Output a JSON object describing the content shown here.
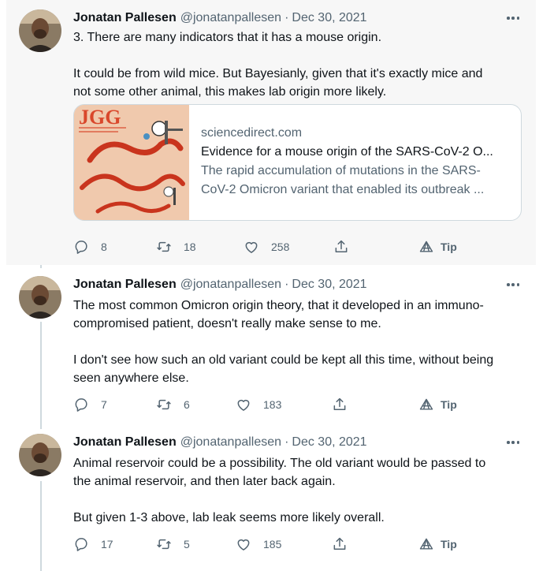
{
  "tweets": [
    {
      "name": "Jonatan Pallesen",
      "handle": "@jonatanpallesen",
      "separator": "·",
      "date": "Dec 30, 2021",
      "lines": [
        "3. There are many indicators that it has a mouse origin.",
        "",
        "It could be from wild mice. But Bayesianly, given that it's exactly mice and",
        "not some other animal, this makes lab origin more likely."
      ],
      "card": {
        "thumb_text": "JGG",
        "domain": "sciencedirect.com",
        "title": "Evidence for a mouse origin of the SARS-CoV-2 O...",
        "description_lines": [
          "The rapid accumulation of mutations in the SARS-",
          "CoV-2 Omicron variant that enabled its outbreak ..."
        ]
      },
      "actions": {
        "replies": "8",
        "retweets": "18",
        "likes": "258",
        "tip": "Tip"
      }
    },
    {
      "name": "Jonatan Pallesen",
      "handle": "@jonatanpallesen",
      "separator": "·",
      "date": "Dec 30, 2021",
      "lines": [
        "The most common Omicron origin theory, that it developed in an immuno-",
        "compromised patient, doesn't really make sense to me.",
        "",
        "I don't see how such an old variant could be kept all this time, without being",
        "seen anywhere else."
      ],
      "actions": {
        "replies": "7",
        "retweets": "6",
        "likes": "183",
        "tip": "Tip"
      }
    },
    {
      "name": "Jonatan Pallesen",
      "handle": "@jonatanpallesen",
      "separator": "·",
      "date": "Dec 30, 2021",
      "lines": [
        "Animal reservoir could be a possibility. The old variant would be passed to",
        "the animal reservoir, and then later back again.",
        "",
        "But given 1-3 above, lab leak seems more likely overall."
      ],
      "actions": {
        "replies": "17",
        "retweets": "5",
        "likes": "185",
        "tip": "Tip"
      }
    }
  ],
  "icons": {
    "reply": "reply-icon",
    "retweet": "retweet-icon",
    "like": "heart-icon",
    "share": "share-icon",
    "tip": "tip-icon",
    "more": "more-icon"
  },
  "colors": {
    "text": "#0f1419",
    "muted": "#536471",
    "border": "#cfd9de",
    "highlight_bg": "#f7f7f7",
    "thumb_bg": "#f0c9ad",
    "thumb_accent": "#d9472b"
  }
}
